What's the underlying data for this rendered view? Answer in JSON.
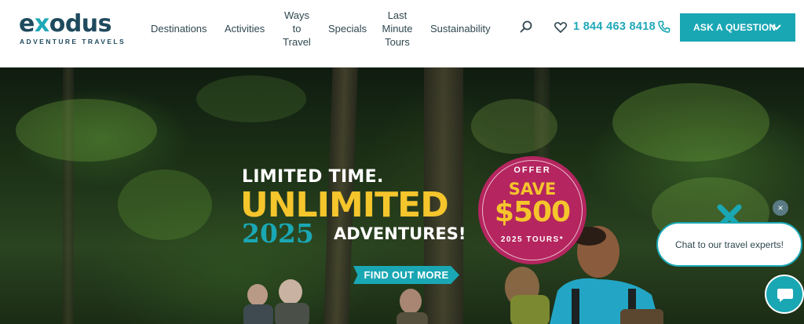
{
  "brand": {
    "logo_word_pre": "e",
    "logo_word_x": "x",
    "logo_word_post": "odus",
    "logo_sub": "ADVENTURE TRAVELS"
  },
  "nav": {
    "items": [
      {
        "label": "Destinations"
      },
      {
        "label": "Activities"
      },
      {
        "line1": "Ways",
        "line2": "to",
        "line3": "Travel"
      },
      {
        "label": "Specials"
      },
      {
        "line1": "Last",
        "line2": "Minute",
        "line3": "Tours"
      },
      {
        "label": "Sustainability"
      }
    ],
    "search_icon": "search-icon",
    "wishlist_icon": "heart-icon",
    "phone_number": "1 844 463 8418",
    "phone_icon": "phone-icon",
    "ask_button": "ASK A QUESTION"
  },
  "hero": {
    "line1": "LIMITED TIME.",
    "line2": "UNLIMITED",
    "year": "2025",
    "line3": "ADVENTURES!",
    "cta": "FIND OUT MORE",
    "badge": {
      "offer": "OFFER",
      "save": "SAVE",
      "amount": "$500",
      "tours": "2025 TOURS*"
    }
  },
  "chat": {
    "close": "×",
    "prompt": "Chat to our travel experts!",
    "launch_icon": "chat-bubble-icon"
  },
  "colors": {
    "brand_dark": "#1f4a5e",
    "accent_teal": "#1aa7b4",
    "badge_magenta": "#b5255f",
    "headline_yellow": "#f5c52c"
  }
}
